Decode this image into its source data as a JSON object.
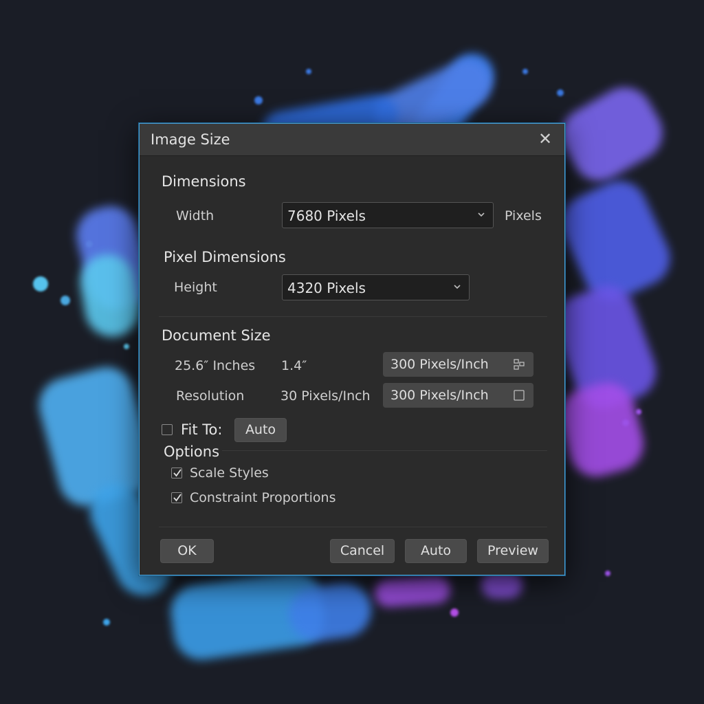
{
  "dialog": {
    "title": "Image Size",
    "close_icon": "close-icon"
  },
  "dimensions": {
    "heading": "Dimensions",
    "width_label": "Width",
    "width_value": "7680 Pixels",
    "width_unit": "Pixels"
  },
  "pixel_dimensions": {
    "heading": "Pixel Dimensions",
    "height_label": "Height",
    "height_value": "4320 Pixels"
  },
  "document_size": {
    "heading": "Document Size",
    "row1_label": "25.6″ Inches",
    "row1_value": "1.4″",
    "row1_field": "300 Pixels/Inch",
    "row2_label": "Resolution",
    "row2_value": "30 Pixels/Inch",
    "row2_field": "300 Pixels/Inch"
  },
  "fit_to": {
    "label": "Fit To:",
    "checked": false,
    "button": "Auto"
  },
  "options": {
    "heading": "Options",
    "scale_styles": {
      "label": "Scale Styles",
      "checked": true
    },
    "constraint": {
      "label": "Constraint Proportions",
      "checked": true
    }
  },
  "footer": {
    "ok": "OK",
    "cancel": "Cancel",
    "auto": "Auto",
    "preview": "Preview"
  },
  "colors": {
    "accent_border": "#4a9fd6",
    "dialog_bg": "#2b2b2b",
    "titlebar_bg": "#3a3a3a"
  }
}
